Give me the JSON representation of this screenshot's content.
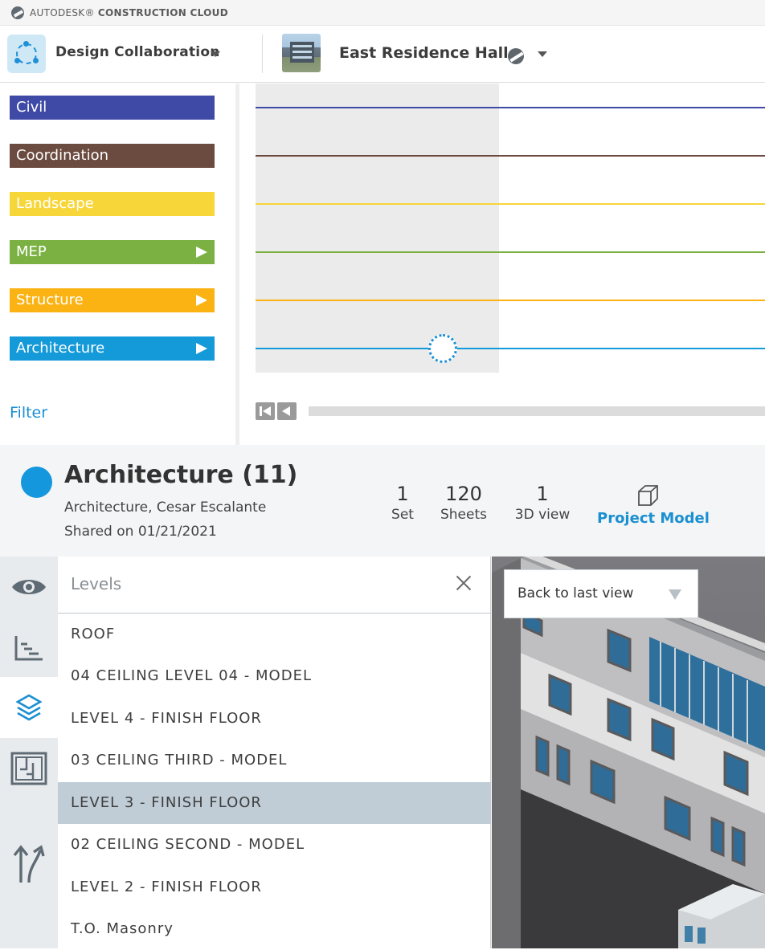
{
  "brand": {
    "prefix": "AUTODESK",
    "suffix": "CONSTRUCTION CLOUD"
  },
  "header": {
    "module_title": "Design Collaboration",
    "project_title": "East Residence Hall"
  },
  "disciplines": [
    {
      "label": "Civil",
      "color": "#3f4aa6",
      "expandable": false
    },
    {
      "label": "Coordination",
      "color": "#6b4a3f",
      "expandable": false
    },
    {
      "label": "Landscape",
      "color": "#f7d63a",
      "expandable": false
    },
    {
      "label": "MEP",
      "color": "#7ab142",
      "expandable": true
    },
    {
      "label": "Structure",
      "color": "#fbb314",
      "expandable": true
    },
    {
      "label": "Architecture",
      "color": "#149ad9",
      "expandable": true
    }
  ],
  "filter_label": "Filter",
  "package": {
    "title": "Architecture (11)",
    "subtitle": "Architecture, Cesar Escalante",
    "shared": "Shared on 01/21/2021",
    "accent": "#1597dd",
    "stats": [
      {
        "num": "1",
        "label": "Set"
      },
      {
        "num": "120",
        "label": "Sheets"
      },
      {
        "num": "1",
        "label": "3D view"
      }
    ],
    "project_model_label": "Project Model"
  },
  "levels_panel": {
    "title": "Levels",
    "items": [
      "ROOF",
      "04 CEILING LEVEL 04 - MODEL",
      "LEVEL 4 - FINISH FLOOR",
      "03 CEILING THIRD - MODEL",
      "LEVEL 3 - FINISH FLOOR",
      "02 CEILING SECOND - MODEL",
      "LEVEL 2 - FINISH FLOOR",
      "T.O. Masonry"
    ],
    "selected_index": 4
  },
  "viewer": {
    "back_label": "Back to last view"
  },
  "rail_icons": [
    "eye-icon",
    "section-icon",
    "layers-icon",
    "sheet-icon",
    "split-arrows-icon"
  ]
}
